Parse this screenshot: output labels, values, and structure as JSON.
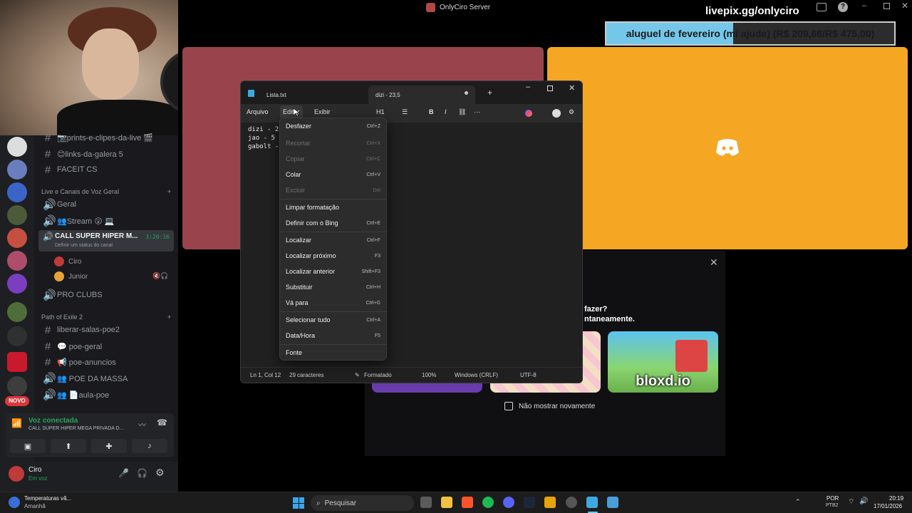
{
  "stream": {
    "server_title": "OnlyCiro Server",
    "livepix": "livepix.gg/onlyciro",
    "donation_text": "aluguel de fevereiro (mi ajude) (R$ 209,66/R$ 475,00)",
    "donation_progress": 0.4414,
    "colors": {
      "red_tile": "#99444d",
      "yellow_tile": "#f5a623",
      "donation_fill": "#74c7e8"
    }
  },
  "discord": {
    "channels": [
      {
        "icon": "#",
        "label": "📷prints-e-clipes-da-live 🎬"
      },
      {
        "icon": "#",
        "label": "😊links-da-galera 5"
      },
      {
        "icon": "#",
        "label": "FACEIT CS"
      }
    ],
    "category_voice": "Live e Canais de Voz Geral",
    "voice_channels": [
      {
        "label": "Geral"
      },
      {
        "label": "👥Stream 😲 💻"
      }
    ],
    "active_channel": {
      "label": "CALL SUPER HIPER M...",
      "timer": "3:20:16",
      "status": "Definir um status do canal"
    },
    "voice_users": [
      {
        "name": "Ciro",
        "color": "#c03a3a"
      },
      {
        "name": "Junior",
        "color": "#e8a23a"
      }
    ],
    "pro_clubs": "PRO CLUBS",
    "category_poe": "Path of Exile 2",
    "poe_channels": [
      {
        "icon": "#",
        "label": "liberar-salas-poe2"
      },
      {
        "icon": "#",
        "label": "💬 poe-geral"
      },
      {
        "icon": "#",
        "label": "📢 poe-anuncios"
      },
      {
        "icon": "🔊",
        "label": "👥 POE DA MASSA"
      },
      {
        "icon": "🔊",
        "label": "👥 📄aula-poe"
      }
    ],
    "novo_badge": "NOVO",
    "voice_connected": "Voz conectada",
    "voice_connected_channel": "CALL SUPER HIPER MEGA PRIVADA D...",
    "user_name": "Ciro",
    "user_status": "Em voz"
  },
  "notepad": {
    "tabs": [
      {
        "label": "Lista.txt"
      },
      {
        "label": "dizi - 23,5"
      }
    ],
    "menu": {
      "file": "Arquivo",
      "edit": "Editar",
      "view": "Exibir",
      "heading": "H1"
    },
    "content_lines": [
      "dizi - 2",
      "jao - 5",
      "gabolt -"
    ],
    "edit_menu": [
      {
        "label": "Desfazer",
        "shortcut": "Ctrl+Z",
        "enabled": true
      },
      {
        "label": "Recortar",
        "shortcut": "Ctrl+X",
        "enabled": false
      },
      {
        "label": "Copiar",
        "shortcut": "Ctrl+C",
        "enabled": false
      },
      {
        "label": "Colar",
        "shortcut": "Ctrl+V",
        "enabled": true
      },
      {
        "label": "Excluir",
        "shortcut": "Del",
        "enabled": false
      },
      {
        "label": "Limpar formatação",
        "shortcut": "",
        "enabled": true
      },
      {
        "label": "Definir com o Bing",
        "shortcut": "Ctrl+E",
        "enabled": true
      },
      {
        "label": "Localizar",
        "shortcut": "Ctrl+F",
        "enabled": true
      },
      {
        "label": "Localizar próximo",
        "shortcut": "F3",
        "enabled": true
      },
      {
        "label": "Localizar anterior",
        "shortcut": "Shift+F3",
        "enabled": true
      },
      {
        "label": "Substituir",
        "shortcut": "Ctrl+H",
        "enabled": true
      },
      {
        "label": "Vá para",
        "shortcut": "Ctrl+G",
        "enabled": true
      },
      {
        "label": "Selecionar tudo",
        "shortcut": "Ctrl+A",
        "enabled": true
      },
      {
        "label": "Data/Hora",
        "shortcut": "F5",
        "enabled": true
      },
      {
        "label": "Fonte",
        "shortcut": "",
        "enabled": true
      }
    ],
    "status": {
      "position": "Ln 1, Col 12",
      "chars": "29 caracteres",
      "format": "Formatado",
      "zoom": "100%",
      "line_ending": "Windows (CRLF)",
      "encoding": "UTF-8"
    }
  },
  "activity": {
    "question_tail": "fazer?",
    "subtitle_tail": "ntaneamente.",
    "game_name": "bloxd.io",
    "dont_show": "Não mostrar novamente"
  },
  "taskbar": {
    "weather_title": "Temperaturas vã...",
    "weather_sub": "Amanhã",
    "search_placeholder": "Pesquisar",
    "lang": "POR",
    "lang_sub": "PTB2",
    "time": "20:19",
    "date": "17/01/2026"
  }
}
